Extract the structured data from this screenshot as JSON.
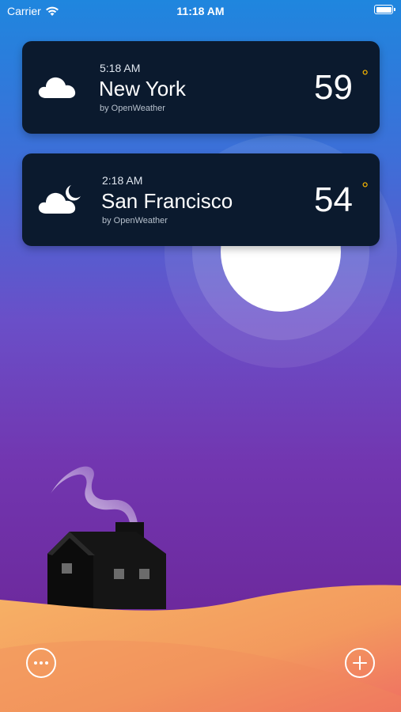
{
  "status_bar": {
    "carrier": "Carrier",
    "time": "11:18 AM",
    "icons": [
      "wifi-icon",
      "battery-icon"
    ]
  },
  "cards": [
    {
      "time": "5:18 AM",
      "city": "New York",
      "provider": "by OpenWeather",
      "temp": "59",
      "degree": "°",
      "icon": "cloud-icon"
    },
    {
      "time": "2:18 AM",
      "city": "San Francisco",
      "provider": "by OpenWeather",
      "temp": "54",
      "degree": "°",
      "icon": "cloud-moon-icon"
    }
  ],
  "bottom_bar": {
    "left_icon": "more-icon",
    "right_icon": "add-icon"
  },
  "colors": {
    "card_bg": "#0b1a2e",
    "degree_accent": "#f5b400",
    "sky_top": "#1f86de",
    "sky_bottom": "#6a2a9a",
    "dune": "#f0945a"
  }
}
